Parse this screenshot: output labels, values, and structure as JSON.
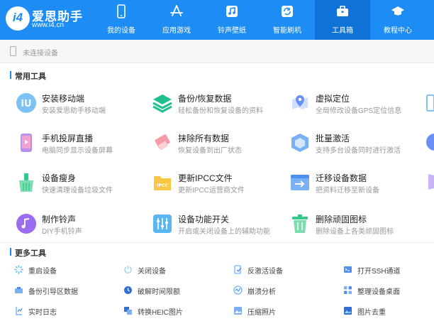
{
  "app": {
    "name": "爱思助手",
    "url": "www.i4.cn",
    "logo_mark": "i4"
  },
  "nav": [
    {
      "label": "我的设备",
      "icon": "phone-icon"
    },
    {
      "label": "应用游戏",
      "icon": "app-store-icon"
    },
    {
      "label": "铃声壁纸",
      "icon": "music-icon"
    },
    {
      "label": "智能刷机",
      "icon": "refresh-icon"
    },
    {
      "label": "工具箱",
      "icon": "toolbox-icon",
      "active": true
    },
    {
      "label": "教程中心",
      "icon": "graduation-cap-icon"
    }
  ],
  "device_bar": {
    "status": "未连接设备"
  },
  "common_tools": {
    "title": "常用工具",
    "items": [
      {
        "name": "安装移动端",
        "desc": "安装爱思助手移动端",
        "icon": "i4-install-icon"
      },
      {
        "name": "备份/恢复数据",
        "desc": "轻松备份和恢复设备的资料",
        "icon": "layers-icon"
      },
      {
        "name": "虚拟定位",
        "desc": "全局修改设备GPS定位信息",
        "icon": "location-pin-icon"
      },
      {
        "name": "手机投屏直播",
        "desc": "电脑同步显示设备屏幕",
        "icon": "screen-mirror-icon"
      },
      {
        "name": "抹除所有数据",
        "desc": "恢复设备到出厂状态",
        "icon": "eraser-icon"
      },
      {
        "name": "批量激活",
        "desc": "支持多台设备同时进行激活",
        "icon": "batch-activate-icon"
      },
      {
        "name": "设备瘦身",
        "desc": "快速清理设备垃圾文件",
        "icon": "broom-icon"
      },
      {
        "name": "更新IPCC文件",
        "desc": "更新IPCC运营商文件",
        "icon": "ipcc-folder-icon"
      },
      {
        "name": "迁移设备数据",
        "desc": "把资料迁移至新设备",
        "icon": "migrate-icon"
      },
      {
        "name": "制作铃声",
        "desc": "DIY手机铃声",
        "icon": "ringtone-icon"
      },
      {
        "name": "设备功能开关",
        "desc": "开启或关闭设备上的辅助功能",
        "icon": "sliders-icon"
      },
      {
        "name": "删除顽固图标",
        "desc": "删除设备上各类顽固图标",
        "icon": "trash-icon"
      }
    ]
  },
  "more_tools": {
    "title": "更多工具",
    "items": [
      {
        "name": "重启设备",
        "icon": "restart-icon"
      },
      {
        "name": "关闭设备",
        "icon": "power-icon"
      },
      {
        "name": "反激活设备",
        "icon": "deactivate-icon"
      },
      {
        "name": "打开SSH通道",
        "icon": "terminal-icon"
      },
      {
        "name": "备份引导区数据",
        "icon": "backup-boot-icon"
      },
      {
        "name": "破解时间限额",
        "icon": "clock-icon"
      },
      {
        "name": "崩溃分析",
        "icon": "crash-analysis-icon"
      },
      {
        "name": "整理设备桌面",
        "icon": "grid-icon"
      },
      {
        "name": "实时日志",
        "icon": "log-icon"
      },
      {
        "name": "转换HEIC图片",
        "icon": "heic-convert-icon"
      },
      {
        "name": "压缩照片",
        "icon": "compress-photo-icon"
      },
      {
        "name": "图片去重",
        "icon": "dedupe-image-icon"
      }
    ]
  },
  "colors": {
    "header": "#1e8cf5",
    "header_active": "#0f72d6",
    "accent": "#1e8cf5"
  }
}
